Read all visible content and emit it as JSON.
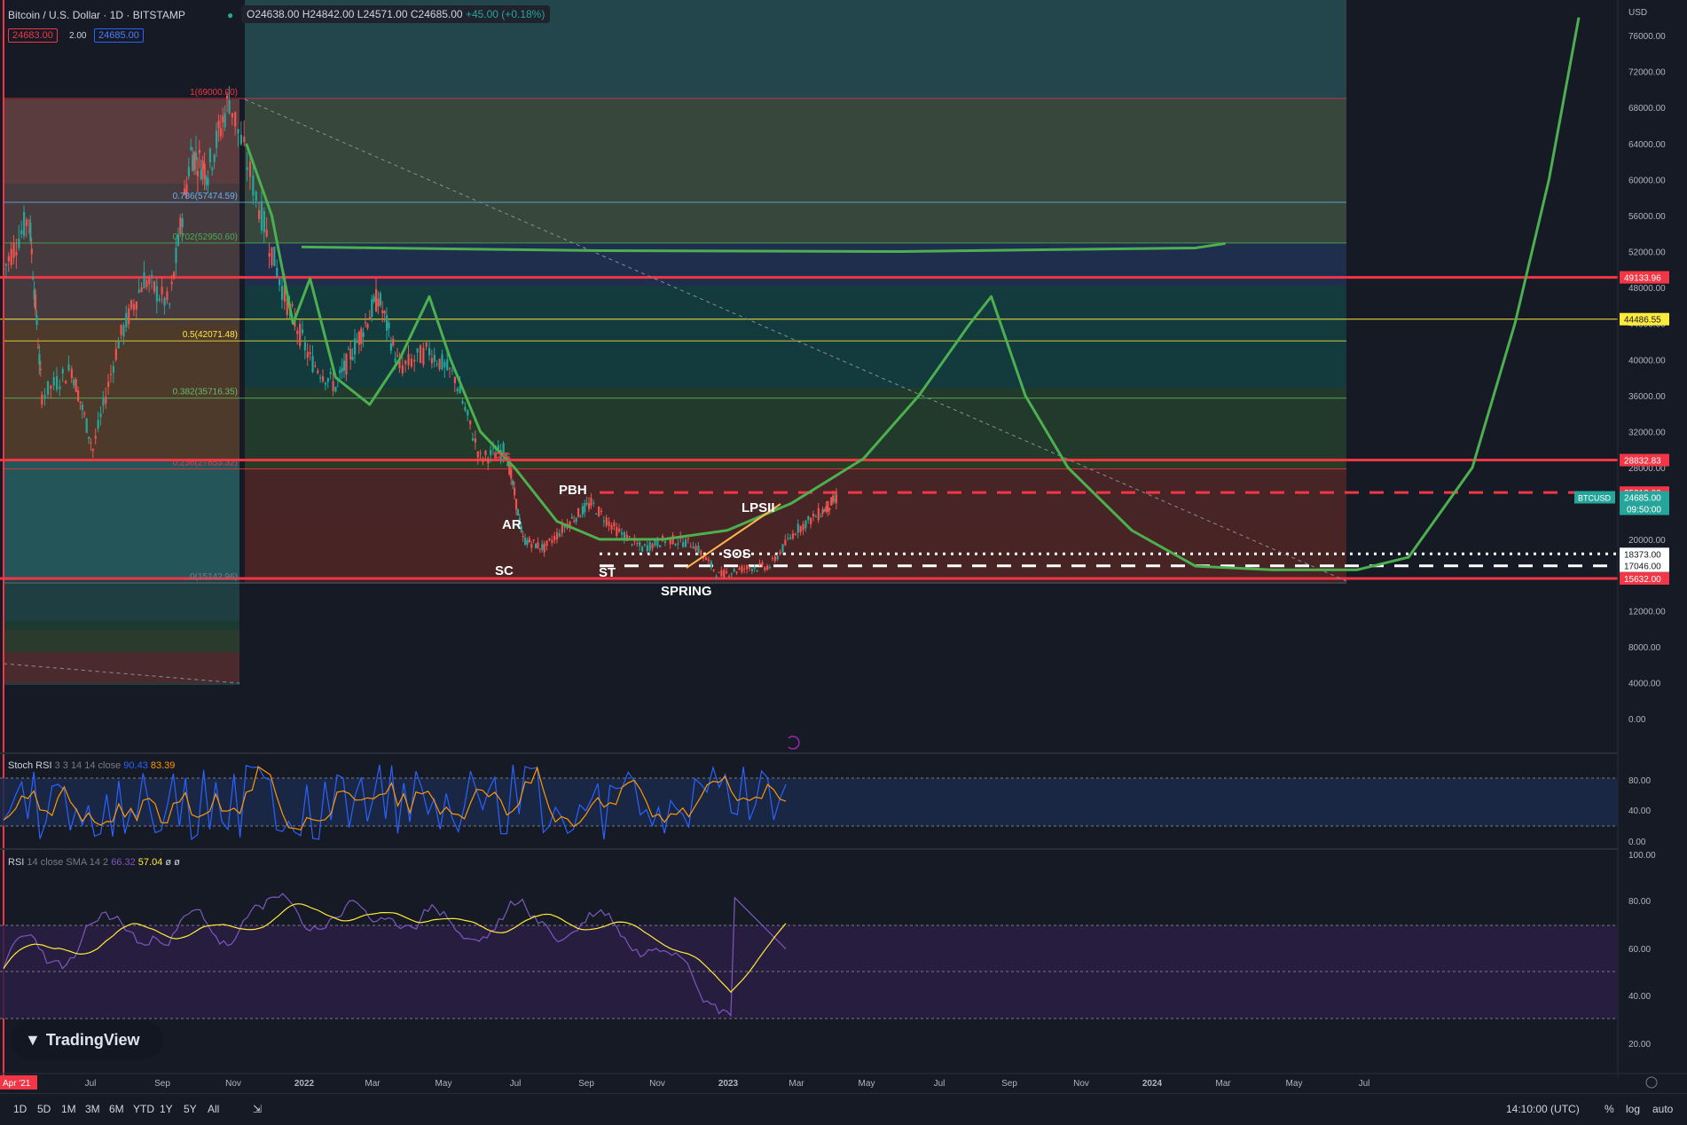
{
  "header": {
    "symbol": "Bitcoin / U.S. Dollar · 1D · BITSTAMP",
    "open": "O24638.00",
    "high": "H24842.00",
    "low": "L24571.00",
    "close": "C24685.00",
    "change": "+45.00 (+0.18%)",
    "bid": "24683.00",
    "spread": "2.00",
    "ask": "24685.00"
  },
  "price_axis": {
    "currency": "USD",
    "ticks": [
      "76000.00",
      "72000.00",
      "68000.00",
      "64000.00",
      "60000.00",
      "56000.00",
      "52000.00",
      "48000.00",
      "44000.00",
      "40000.00",
      "36000.00",
      "32000.00",
      "28000.00",
      "20000.00",
      "12000.00",
      "8000.00",
      "4000.00",
      "0.00"
    ],
    "tags": [
      {
        "label": "49133.96",
        "color": "#f23645"
      },
      {
        "label": "44486.55",
        "color": "#ffeb3b"
      },
      {
        "label": "28832.83",
        "color": "#f23645"
      },
      {
        "label": "25212.00",
        "color": "#f23645"
      },
      {
        "label": "24685.00",
        "color": "#26a69a",
        "extra": "09:50:00",
        "symbol": "BTCUSD"
      },
      {
        "label": "18373.00",
        "color": "#ffffff"
      },
      {
        "label": "17046.00",
        "color": "#ffffff"
      },
      {
        "label": "15632.00",
        "color": "#f23645"
      }
    ]
  },
  "time_axis": [
    "Apr '21",
    "Jul",
    "Sep",
    "Nov",
    "2022",
    "Mar",
    "May",
    "Jul",
    "Sep",
    "Nov",
    "2023",
    "Mar",
    "May",
    "Jul",
    "Sep",
    "Nov",
    "2024",
    "Mar",
    "May",
    "Jul"
  ],
  "fib_labels": [
    "1(69000.00)",
    "0.786(57474.59)",
    "0.702(52950.60)",
    "0.5(42071.48)",
    "0.382(35716.35)",
    "0.236(27853.32)",
    "0(15142.96)"
  ],
  "wyckoff_labels": [
    "PS",
    "PBH",
    "AR",
    "SC",
    "ST",
    "SPRING",
    "SOS",
    "LPSII"
  ],
  "stoch_rsi": {
    "label": "Stoch RSI",
    "params": "3 3 14 14 close",
    "k": "90.43",
    "d": "83.39",
    "ticks": [
      "80.00",
      "40.00",
      "0.00"
    ]
  },
  "rsi": {
    "label": "RSI",
    "params": "14 close SMA 14 2",
    "value": "66.32",
    "sma": "57.04",
    "extra": "ø ø",
    "ticks": [
      "100.00",
      "80.00",
      "60.00",
      "40.00",
      "20.00"
    ]
  },
  "bottom_bar": {
    "timeframes": [
      "1D",
      "5D",
      "1M",
      "3M",
      "6M",
      "YTD",
      "1Y",
      "5Y",
      "All"
    ],
    "clock": "14:10:00 (UTC)",
    "percent": "%",
    "log": "log",
    "auto": "auto"
  },
  "brand": "TradingView",
  "chart_data": {
    "type": "line",
    "title": "Bitcoin / U.S. Dollar · 1D · BITSTAMP",
    "xlabel": "",
    "ylabel": "USD",
    "ylim": [
      0,
      76000
    ],
    "series": [
      {
        "values": [
          [
            0,
            50000
          ],
          [
            0.06,
            56000
          ],
          [
            0.09,
            36000
          ],
          [
            0.16,
            39000
          ],
          [
            0.21,
            30000
          ],
          [
            0.27,
            42000
          ],
          [
            0.33,
            49000
          ],
          [
            0.39,
            46000
          ],
          [
            0.44,
            63000
          ],
          [
            0.48,
            61000
          ],
          [
            0.53,
            69000
          ],
          [
            0.6,
            57000
          ],
          [
            0.66,
            47000
          ],
          [
            0.72,
            40000
          ],
          [
            0.78,
            37000
          ],
          [
            0.83,
            42000
          ],
          [
            0.88,
            47000
          ],
          [
            0.93,
            39000
          ],
          [
            1.0,
            41000
          ],
          [
            1.06,
            38000
          ],
          [
            1.12,
            29000
          ],
          [
            1.18,
            30000
          ],
          [
            1.22,
            20000
          ],
          [
            1.27,
            19000
          ],
          [
            1.33,
            22000
          ],
          [
            1.38,
            24000
          ],
          [
            1.44,
            21000
          ],
          [
            1.5,
            19000
          ],
          [
            1.56,
            20000
          ],
          [
            1.62,
            19500
          ],
          [
            1.68,
            16000
          ],
          [
            1.74,
            16800
          ],
          [
            1.8,
            17000
          ],
          [
            1.86,
            21000
          ],
          [
            1.92,
            23000
          ],
          [
            1.96,
            24685
          ]
        ]
      },
      {
        "values": [
          [
            0.57,
            64000
          ],
          [
            0.63,
            56000
          ],
          [
            0.68,
            44000
          ],
          [
            0.72,
            49000
          ],
          [
            0.78,
            38000
          ],
          [
            0.86,
            35000
          ],
          [
            0.93,
            40000
          ],
          [
            1.0,
            47000
          ],
          [
            1.05,
            40000
          ],
          [
            1.12,
            32000
          ],
          [
            1.2,
            28000
          ],
          [
            1.3,
            22000
          ],
          [
            1.4,
            20000
          ],
          [
            1.55,
            20000
          ],
          [
            1.7,
            21000
          ],
          [
            1.85,
            24000
          ],
          [
            2.02,
            29000
          ],
          [
            2.15,
            36000
          ],
          [
            2.27,
            44000
          ],
          [
            2.32,
            47000
          ],
          [
            2.4,
            36000
          ],
          [
            2.5,
            28000
          ],
          [
            2.65,
            21000
          ],
          [
            2.8,
            17000
          ],
          [
            2.98,
            16600
          ],
          [
            3.18,
            16600
          ],
          [
            3.3,
            18000
          ],
          [
            3.45,
            28000
          ],
          [
            3.55,
            44000
          ],
          [
            3.63,
            60000
          ],
          [
            3.7,
            78000
          ]
        ]
      },
      {
        "values": [
          [
            0.7,
            52500
          ],
          [
            1.4,
            52100
          ],
          [
            2.1,
            52000
          ],
          [
            2.8,
            52400
          ],
          [
            2.87,
            52900
          ]
        ]
      }
    ],
    "x_domain_years": [
      2021.25,
      2024.55
    ],
    "levels": [
      {
        "value": 49133.96,
        "style": "solid",
        "color": "#f23645"
      },
      {
        "value": 44486.55,
        "style": "solid",
        "color": "#ffeb3b"
      },
      {
        "value": 28832.83,
        "style": "solid",
        "color": "#f23645"
      },
      {
        "value": 25212.0,
        "style": "dashed",
        "color": "#f23645"
      },
      {
        "value": 18373.0,
        "style": "dotted",
        "color": "#ffffff"
      },
      {
        "value": 17046.0,
        "style": "dashed",
        "color": "#ffffff"
      },
      {
        "value": 15632.0,
        "style": "solid",
        "color": "#f23645"
      }
    ]
  }
}
